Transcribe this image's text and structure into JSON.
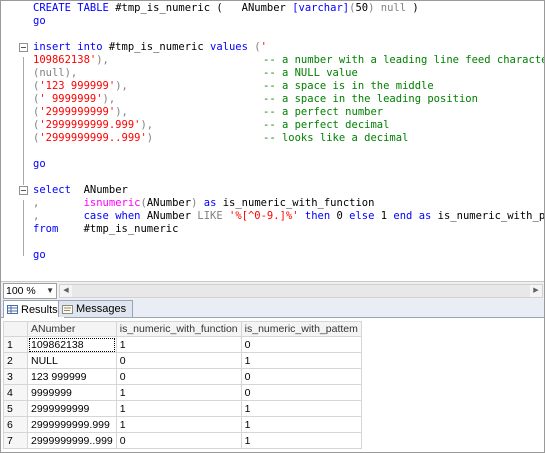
{
  "editor": {
    "lines": [
      {
        "fold": "",
        "segs": [
          [
            "kw",
            "CREATE TABLE "
          ],
          [
            "blk",
            "#tmp_is_numeric ( "
          ],
          [
            "blk",
            "  ANumber "
          ],
          [
            "kw",
            "[varchar]"
          ],
          [
            "gray",
            "("
          ],
          [
            "blk",
            "50"
          ],
          [
            "gray",
            ")"
          ],
          [
            "blk",
            " "
          ],
          [
            "gray",
            "null"
          ],
          [
            "blk",
            " )"
          ]
        ],
        "comment": ""
      },
      {
        "fold": "",
        "segs": [
          [
            "kw",
            "go"
          ]
        ],
        "comment": ""
      },
      {
        "fold": "",
        "segs": [],
        "comment": ""
      },
      {
        "fold": "open",
        "segs": [
          [
            "kw",
            "insert into "
          ],
          [
            "blk",
            "#tmp_is_numeric "
          ],
          [
            "kw",
            "values "
          ],
          [
            "gray",
            "("
          ],
          [
            "str",
            "'"
          ]
        ],
        "comment": ""
      },
      {
        "fold": "",
        "segs": [
          [
            "str",
            "109862138'"
          ],
          [
            "gray",
            "),"
          ]
        ],
        "comment": "-- a number with a leading line feed character"
      },
      {
        "fold": "",
        "segs": [
          [
            "gray",
            "(null),"
          ]
        ],
        "comment": "-- a NULL value"
      },
      {
        "fold": "",
        "segs": [
          [
            "gray",
            "("
          ],
          [
            "str",
            "'123 999999'"
          ],
          [
            "gray",
            "),"
          ]
        ],
        "comment": "-- a space is in the middle"
      },
      {
        "fold": "",
        "segs": [
          [
            "gray",
            "("
          ],
          [
            "str",
            "' 9999999'"
          ],
          [
            "gray",
            "),"
          ]
        ],
        "comment": "-- a space in the leading position"
      },
      {
        "fold": "",
        "segs": [
          [
            "gray",
            "("
          ],
          [
            "str",
            "'2999999999'"
          ],
          [
            "gray",
            "),"
          ]
        ],
        "comment": "-- a perfect number"
      },
      {
        "fold": "",
        "segs": [
          [
            "gray",
            "("
          ],
          [
            "str",
            "'2999999999.999'"
          ],
          [
            "gray",
            "),"
          ]
        ],
        "comment": "-- a perfect decimal"
      },
      {
        "fold": "",
        "segs": [
          [
            "gray",
            "("
          ],
          [
            "str",
            "'2999999999..999'"
          ],
          [
            "gray",
            ")"
          ]
        ],
        "comment": "-- looks like a decimal"
      },
      {
        "fold": "",
        "segs": [],
        "comment": ""
      },
      {
        "fold": "",
        "segs": [
          [
            "kw",
            "go"
          ]
        ],
        "comment": ""
      },
      {
        "fold": "",
        "segs": [],
        "comment": ""
      },
      {
        "fold": "open",
        "segs": [
          [
            "kw",
            "select"
          ],
          [
            "blk",
            "  ANumber"
          ]
        ],
        "comment": ""
      },
      {
        "fold": "",
        "segs": [
          [
            "gray",
            ","
          ],
          [
            "blk",
            "       "
          ],
          [
            "fn",
            "isnumeric"
          ],
          [
            "gray",
            "("
          ],
          [
            "blk",
            "ANumber"
          ],
          [
            "gray",
            ")"
          ],
          [
            "blk",
            " "
          ],
          [
            "kw",
            "as "
          ],
          [
            "blk",
            "is_numeric_with_function"
          ]
        ],
        "comment": ""
      },
      {
        "fold": "",
        "segs": [
          [
            "gray",
            ","
          ],
          [
            "blk",
            "       "
          ],
          [
            "kw",
            "case when "
          ],
          [
            "blk",
            "ANumber "
          ],
          [
            "gray",
            "LIKE "
          ],
          [
            "str",
            "'%[^0-9.]%'"
          ],
          [
            "kw",
            " then "
          ],
          [
            "blk",
            "0 "
          ],
          [
            "kw",
            "else "
          ],
          [
            "blk",
            "1 "
          ],
          [
            "kw",
            "end as "
          ],
          [
            "blk",
            "is_numeric_with_pattern"
          ]
        ],
        "comment": ""
      },
      {
        "fold": "",
        "segs": [
          [
            "kw",
            "from"
          ],
          [
            "blk",
            "    #tmp_is_numeric"
          ]
        ],
        "comment": ""
      },
      {
        "fold": "",
        "segs": [],
        "comment": ""
      },
      {
        "fold": "",
        "segs": [
          [
            "kw",
            "go"
          ]
        ],
        "comment": ""
      }
    ]
  },
  "zoom": {
    "value": "100 %"
  },
  "tabs": [
    {
      "label": "Results",
      "icon": "grid-icon",
      "active": true
    },
    {
      "label": "Messages",
      "icon": "messages-icon",
      "active": false
    }
  ],
  "grid": {
    "columns": [
      "ANumber",
      "is_numeric_with_function",
      "is_numeric_with_pattem"
    ],
    "rows": [
      {
        "n": "1",
        "a": "109862138",
        "b": "1",
        "c": "0"
      },
      {
        "n": "2",
        "a": "NULL",
        "b": "0",
        "c": "1"
      },
      {
        "n": "3",
        "a": "123 999999",
        "b": "0",
        "c": "0"
      },
      {
        "n": "4",
        "a": "9999999",
        "b": "1",
        "c": "0"
      },
      {
        "n": "5",
        "a": "2999999999",
        "b": "1",
        "c": "1"
      },
      {
        "n": "6",
        "a": "2999999999.999",
        "b": "1",
        "c": "1"
      },
      {
        "n": "7",
        "a": "2999999999..999",
        "b": "0",
        "c": "1"
      }
    ]
  },
  "colors": {
    "keyword": "#0000ff",
    "string": "#ff0000",
    "comment": "#008000",
    "function": "#ff00ff",
    "operator": "#808080"
  }
}
